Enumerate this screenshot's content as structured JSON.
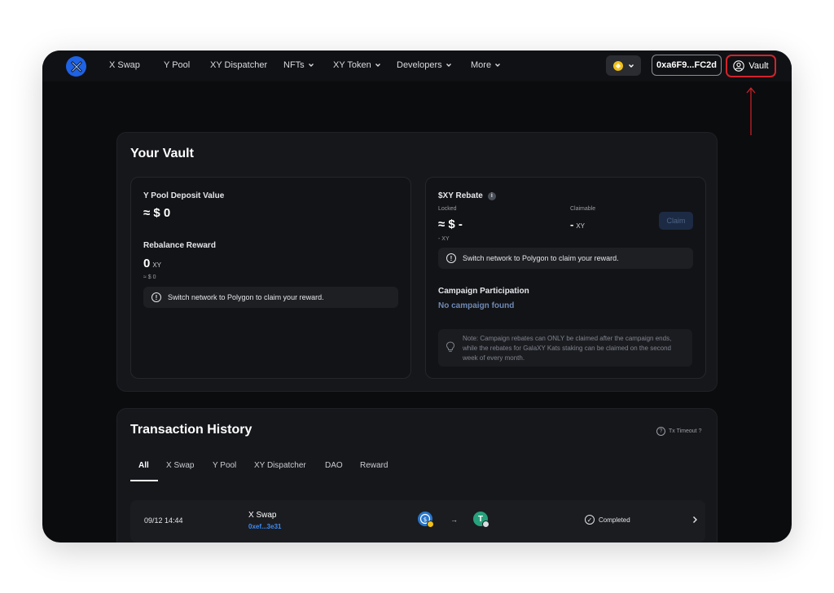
{
  "nav": {
    "items": [
      {
        "label": "X Swap",
        "dropdown": false
      },
      {
        "label": "Y Pool",
        "dropdown": false
      },
      {
        "label": "XY Dispatcher",
        "dropdown": false
      },
      {
        "label": "NFTs",
        "dropdown": true
      },
      {
        "label": "XY Token",
        "dropdown": true
      },
      {
        "label": "Developers",
        "dropdown": true
      },
      {
        "label": "More",
        "dropdown": true
      }
    ],
    "network_icon": "network-coin-icon",
    "wallet_address": "0xa6F9...FC2d",
    "vault_label": "Vault"
  },
  "vault": {
    "title": "Your Vault",
    "left": {
      "deposit_label": "Y Pool Deposit Value",
      "deposit_value": "≈ $ 0",
      "rebalance_label": "Rebalance Reward",
      "rebalance_value": "0",
      "rebalance_unit": "XY",
      "rebalance_usd": "≈ $ 0",
      "notice": "Switch network to Polygon to claim your reward."
    },
    "right": {
      "rebate_label": "$XY Rebate",
      "locked_label": "Locked",
      "locked_value": "≈ $ -",
      "locked_sub": "- XY",
      "claimable_label": "Claimable",
      "claimable_value": "-",
      "claimable_unit": "XY",
      "claim_button": "Claim",
      "notice": "Switch network to Polygon to claim your reward.",
      "campaign_label": "Campaign Participation",
      "campaign_value": "No campaign found",
      "note": "Note: Campaign rebates can ONLY be claimed after the campaign ends, while the rebates for GalaXY Kats staking can be claimed on the second week of every month."
    }
  },
  "transactions": {
    "title": "Transaction History",
    "timeout_label": "Tx Timeout ?",
    "tabs": [
      "All",
      "X Swap",
      "Y Pool",
      "XY Dispatcher",
      "DAO",
      "Reward"
    ],
    "active_tab": "All",
    "rows": [
      {
        "time": "09/12 14:44",
        "type": "X Swap",
        "hash": "0xef...3e31",
        "from_token_icon": "usdc-icon",
        "to_token_icon": "usdt-icon",
        "status": "Completed"
      }
    ]
  },
  "colors": {
    "background": "#0b0c0e",
    "card": "#16171b",
    "accent_blue": "#3e8cf0",
    "highlight_red": "#d2232a"
  }
}
